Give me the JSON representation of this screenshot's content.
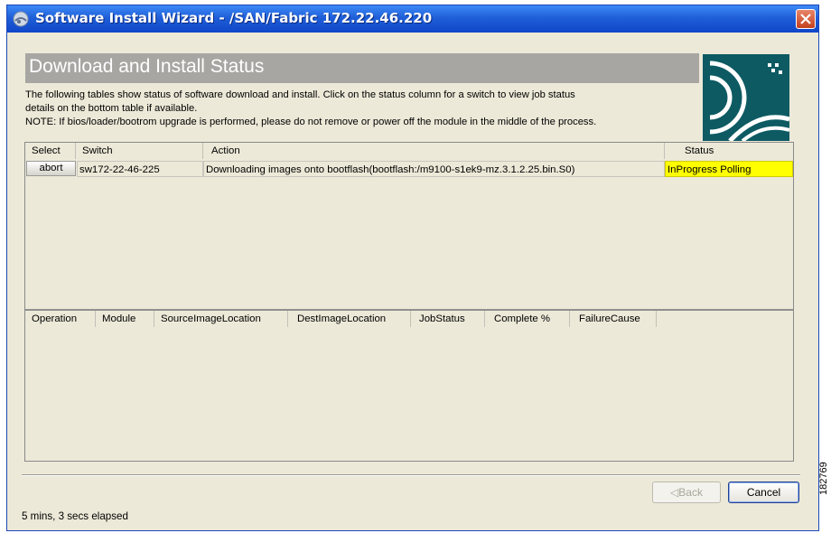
{
  "window": {
    "title": "Software Install Wizard - /SAN/Fabric 172.22.46.220",
    "close_icon": "close-icon",
    "titlebar_color": "#1f5fd8"
  },
  "banner": {
    "title": "Download and Install Status",
    "logo_icon": "cisco-logo"
  },
  "description": {
    "line1": "The following tables show status of software download and install. Click on the status column for a switch to view job status",
    "line2": "details on the bottom table if available.",
    "note": "NOTE: If bios/loader/bootrom upgrade is performed, please do not remove or power off the module in the middle of the process."
  },
  "status_table": {
    "columns": [
      "Select",
      "Switch",
      "Action",
      "Status"
    ],
    "rows": [
      {
        "select_label": "abort",
        "switch": "sw172-22-46-225",
        "action": "Downloading images onto bootflash(bootflash:/m9100-s1ek9-mz.3.1.2.25.bin.S0)",
        "status": "InProgress Polling",
        "status_color": "#ffff00"
      }
    ]
  },
  "job_table": {
    "columns": [
      "Operation",
      "Module",
      "SourceImageLocation",
      "DestImageLocation",
      "JobStatus",
      "Complete %",
      "FailureCause"
    ]
  },
  "footer": {
    "back_label": "◁Back",
    "cancel_label": "Cancel",
    "elapsed": "5 mins, 3 secs elapsed",
    "figure_id": "182769"
  }
}
